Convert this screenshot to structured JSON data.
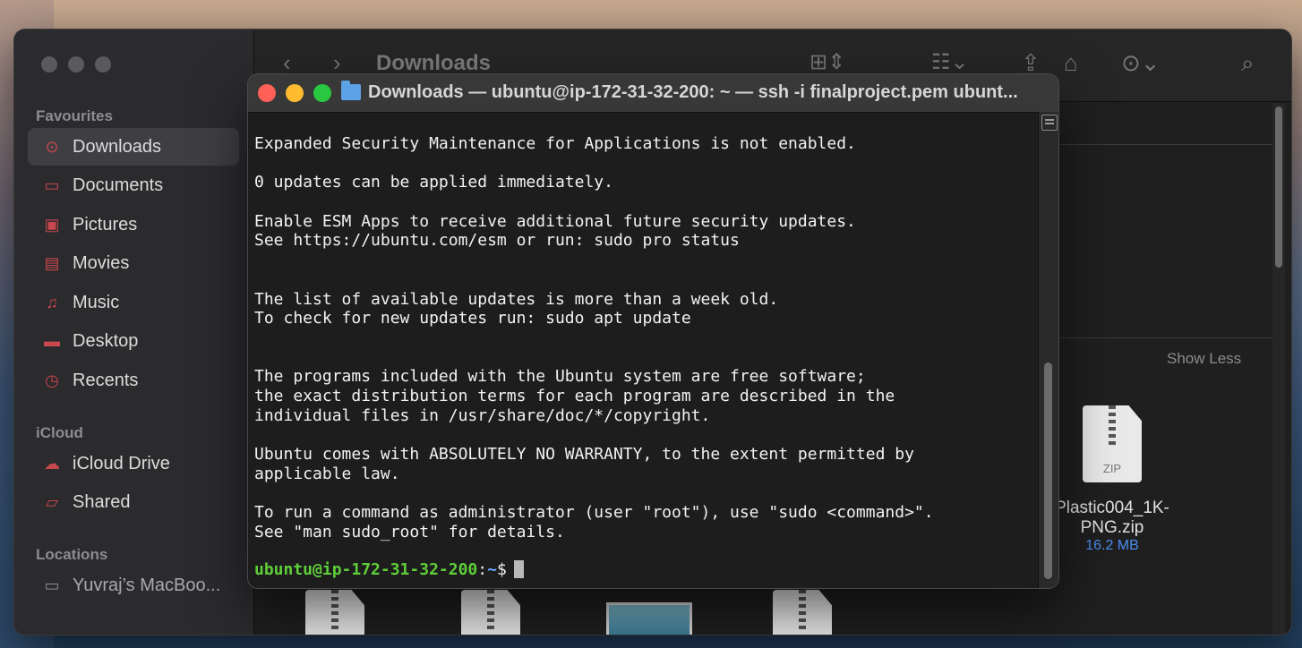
{
  "finder": {
    "title": "Downloads",
    "sidebar": {
      "favourites_title": "Favourites",
      "favourites": [
        {
          "label": "Downloads",
          "icon": "download-circle-icon",
          "selected": true
        },
        {
          "label": "Documents",
          "icon": "document-icon"
        },
        {
          "label": "Pictures",
          "icon": "photo-icon"
        },
        {
          "label": "Movies",
          "icon": "film-icon"
        },
        {
          "label": "Music",
          "icon": "music-note-icon"
        },
        {
          "label": "Desktop",
          "icon": "desktop-icon"
        },
        {
          "label": "Recents",
          "icon": "clock-icon"
        }
      ],
      "icloud_title": "iCloud",
      "icloud": [
        {
          "label": "iCloud Drive",
          "icon": "cloud-icon"
        },
        {
          "label": "Shared",
          "icon": "shared-folder-icon"
        }
      ],
      "locations_title": "Locations",
      "locations": [
        {
          "label": "Yuvraj’s MacBoo...",
          "icon": "laptop-icon"
        }
      ]
    },
    "show_less": "Show Less",
    "file": {
      "name_line1": "Plastic004_1K-",
      "name_line2": "PNG.zip",
      "size": "16.2 MB",
      "icon_text": "ZIP"
    }
  },
  "terminal": {
    "title": "Downloads — ubuntu@ip-172-31-32-200: ~ — ssh -i finalproject.pem ubunt...",
    "lines": [
      "Expanded Security Maintenance for Applications is not enabled.",
      "",
      "0 updates can be applied immediately.",
      "",
      "Enable ESM Apps to receive additional future security updates.",
      "See https://ubuntu.com/esm or run: sudo pro status",
      "",
      "",
      "The list of available updates is more than a week old.",
      "To check for new updates run: sudo apt update",
      "",
      "",
      "The programs included with the Ubuntu system are free software;",
      "the exact distribution terms for each program are described in the",
      "individual files in /usr/share/doc/*/copyright.",
      "",
      "Ubuntu comes with ABSOLUTELY NO WARRANTY, to the extent permitted by",
      "applicable law.",
      "",
      "To run a command as administrator (user \"root\"), use \"sudo <command>\".",
      "See \"man sudo_root\" for details."
    ],
    "prompt_user": "ubuntu@ip-172-31-32-200",
    "prompt_sep": ":",
    "prompt_path": "~",
    "prompt_symbol": "$"
  }
}
